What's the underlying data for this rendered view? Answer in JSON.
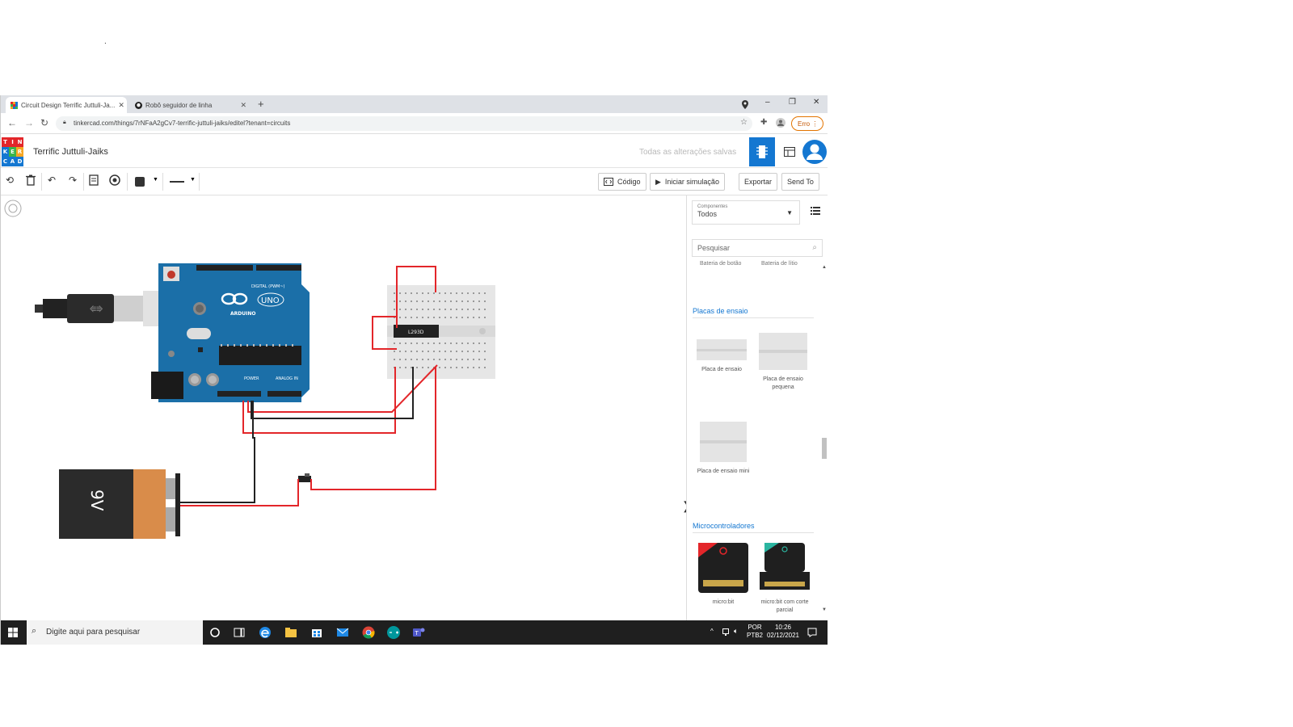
{
  "browser": {
    "tabs": [
      {
        "label": "Circuit Design Terrific Juttuli-Ja...",
        "active": true
      },
      {
        "label": "Robô seguidor de linha",
        "active": false
      }
    ],
    "new_tab": "+",
    "window_controls": {
      "minimize": "–",
      "restore": "❐",
      "close": "✕"
    },
    "url": "tinkercad.com/things/7rNFaA2gCv7-terrific-juttuli-jaiks/editel?tenant=circuits",
    "error_button": "Erro"
  },
  "app": {
    "logo_letters": [
      "T",
      "I",
      "N",
      "K",
      "E",
      "R",
      "C",
      "A",
      "D"
    ],
    "design_title": "Terrific Juttuli-Jaiks",
    "save_status": "Todas as alterações salvas"
  },
  "toolbar": {
    "code_label": "Código",
    "start_sim_label": "Iniciar simulação",
    "export_label": "Exportar",
    "send_label": "Send To"
  },
  "canvas": {
    "battery_label": "9V",
    "arduino_brand": "ARDUINO",
    "arduino_model": "UNO",
    "arduino_digital": "DIGITAL (PWM~)",
    "arduino_power": "POWER",
    "arduino_analog": "ANALOG IN",
    "chip_label": "L293D",
    "collapse_arrow": "❯"
  },
  "panel": {
    "components_label": "Componentes",
    "components_value": "Todos",
    "search_placeholder": "Pesquisar",
    "cut_labels": [
      "Bateria de botão",
      "Bateria de lítio"
    ],
    "sections": [
      {
        "title": "Placas de ensaio",
        "items": [
          "Placa de ensaio",
          "Placa de ensaio pequena",
          "Placa de ensaio mini"
        ]
      },
      {
        "title": "Microcontroladores",
        "items": [
          "micro:bit",
          "micro:bit com corte parcial"
        ]
      }
    ]
  },
  "taskbar": {
    "search_placeholder": "Digite aqui para pesquisar",
    "lang_top": "POR",
    "lang_bottom": "PTB2",
    "time": "10:26",
    "date": "02/12/2021"
  },
  "colors": {
    "accent": "#1477d1",
    "wire_red": "#e3262a",
    "wire_black": "#222222",
    "arduino_blue": "#1b6fa8",
    "battery_orange": "#d98c4a"
  }
}
